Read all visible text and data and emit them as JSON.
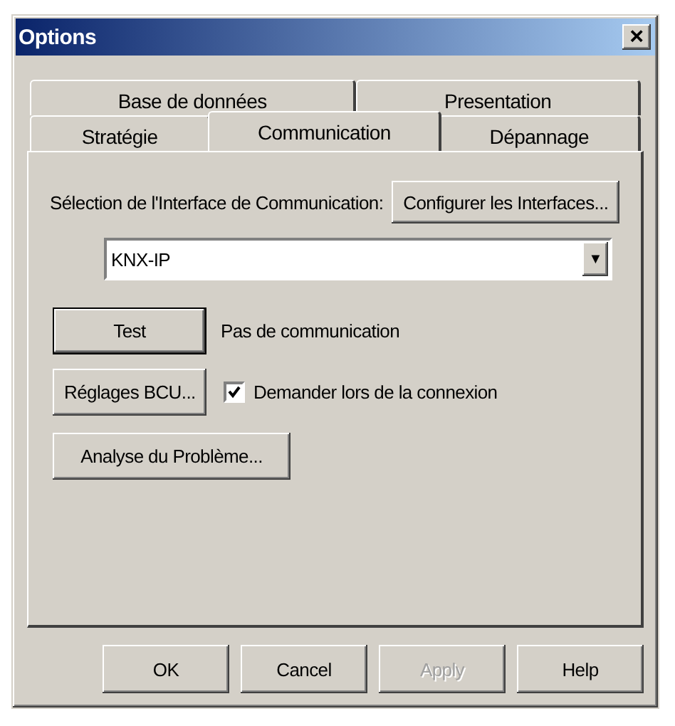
{
  "window": {
    "title": "Options",
    "close": "×"
  },
  "tab_rows": [
    [
      {
        "label": "Base de données",
        "selected": false
      },
      {
        "label": "Presentation",
        "selected": false
      }
    ],
    [
      {
        "label": "Stratégie",
        "selected": false
      },
      {
        "label": "Communication",
        "selected": true
      },
      {
        "label": "Dépannage",
        "selected": false
      }
    ]
  ],
  "panel": {
    "interface_label": "Sélection de l'Interface de Communication:",
    "configure_button": "Configurer les Interfaces...",
    "interface_select": {
      "value": "KNX-IP",
      "arrow": "▼"
    },
    "test_button": {
      "label": "Test",
      "default": true
    },
    "status": "Pas de communication",
    "bcu_button": {
      "label": "Réglages BCU...",
      "default": false
    },
    "ask_checkbox": {
      "label": "Demander lors de la connexion",
      "checked": true
    },
    "analyse_button": {
      "label": "Analyse du Problème...",
      "default": false
    }
  },
  "buttons": [
    {
      "label": "OK",
      "disabled": false
    },
    {
      "label": "Cancel",
      "disabled": false
    },
    {
      "label": "Apply",
      "disabled": true
    },
    {
      "label": "Help",
      "disabled": false
    }
  ]
}
